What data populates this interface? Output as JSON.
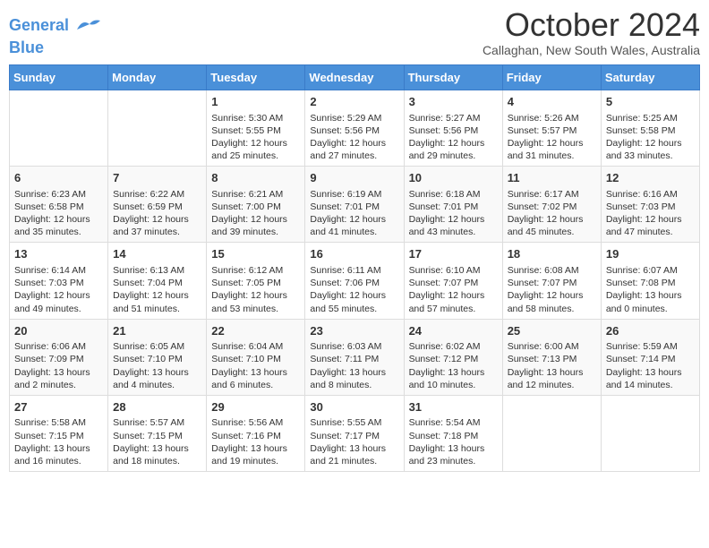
{
  "header": {
    "logo_line1": "General",
    "logo_line2": "Blue",
    "month": "October 2024",
    "location": "Callaghan, New South Wales, Australia"
  },
  "weekdays": [
    "Sunday",
    "Monday",
    "Tuesday",
    "Wednesday",
    "Thursday",
    "Friday",
    "Saturday"
  ],
  "weeks": [
    [
      {
        "day": "",
        "info": ""
      },
      {
        "day": "",
        "info": ""
      },
      {
        "day": "1",
        "info": "Sunrise: 5:30 AM\nSunset: 5:55 PM\nDaylight: 12 hours\nand 25 minutes."
      },
      {
        "day": "2",
        "info": "Sunrise: 5:29 AM\nSunset: 5:56 PM\nDaylight: 12 hours\nand 27 minutes."
      },
      {
        "day": "3",
        "info": "Sunrise: 5:27 AM\nSunset: 5:56 PM\nDaylight: 12 hours\nand 29 minutes."
      },
      {
        "day": "4",
        "info": "Sunrise: 5:26 AM\nSunset: 5:57 PM\nDaylight: 12 hours\nand 31 minutes."
      },
      {
        "day": "5",
        "info": "Sunrise: 5:25 AM\nSunset: 5:58 PM\nDaylight: 12 hours\nand 33 minutes."
      }
    ],
    [
      {
        "day": "6",
        "info": "Sunrise: 6:23 AM\nSunset: 6:58 PM\nDaylight: 12 hours\nand 35 minutes."
      },
      {
        "day": "7",
        "info": "Sunrise: 6:22 AM\nSunset: 6:59 PM\nDaylight: 12 hours\nand 37 minutes."
      },
      {
        "day": "8",
        "info": "Sunrise: 6:21 AM\nSunset: 7:00 PM\nDaylight: 12 hours\nand 39 minutes."
      },
      {
        "day": "9",
        "info": "Sunrise: 6:19 AM\nSunset: 7:01 PM\nDaylight: 12 hours\nand 41 minutes."
      },
      {
        "day": "10",
        "info": "Sunrise: 6:18 AM\nSunset: 7:01 PM\nDaylight: 12 hours\nand 43 minutes."
      },
      {
        "day": "11",
        "info": "Sunrise: 6:17 AM\nSunset: 7:02 PM\nDaylight: 12 hours\nand 45 minutes."
      },
      {
        "day": "12",
        "info": "Sunrise: 6:16 AM\nSunset: 7:03 PM\nDaylight: 12 hours\nand 47 minutes."
      }
    ],
    [
      {
        "day": "13",
        "info": "Sunrise: 6:14 AM\nSunset: 7:03 PM\nDaylight: 12 hours\nand 49 minutes."
      },
      {
        "day": "14",
        "info": "Sunrise: 6:13 AM\nSunset: 7:04 PM\nDaylight: 12 hours\nand 51 minutes."
      },
      {
        "day": "15",
        "info": "Sunrise: 6:12 AM\nSunset: 7:05 PM\nDaylight: 12 hours\nand 53 minutes."
      },
      {
        "day": "16",
        "info": "Sunrise: 6:11 AM\nSunset: 7:06 PM\nDaylight: 12 hours\nand 55 minutes."
      },
      {
        "day": "17",
        "info": "Sunrise: 6:10 AM\nSunset: 7:07 PM\nDaylight: 12 hours\nand 57 minutes."
      },
      {
        "day": "18",
        "info": "Sunrise: 6:08 AM\nSunset: 7:07 PM\nDaylight: 12 hours\nand 58 minutes."
      },
      {
        "day": "19",
        "info": "Sunrise: 6:07 AM\nSunset: 7:08 PM\nDaylight: 13 hours\nand 0 minutes."
      }
    ],
    [
      {
        "day": "20",
        "info": "Sunrise: 6:06 AM\nSunset: 7:09 PM\nDaylight: 13 hours\nand 2 minutes."
      },
      {
        "day": "21",
        "info": "Sunrise: 6:05 AM\nSunset: 7:10 PM\nDaylight: 13 hours\nand 4 minutes."
      },
      {
        "day": "22",
        "info": "Sunrise: 6:04 AM\nSunset: 7:10 PM\nDaylight: 13 hours\nand 6 minutes."
      },
      {
        "day": "23",
        "info": "Sunrise: 6:03 AM\nSunset: 7:11 PM\nDaylight: 13 hours\nand 8 minutes."
      },
      {
        "day": "24",
        "info": "Sunrise: 6:02 AM\nSunset: 7:12 PM\nDaylight: 13 hours\nand 10 minutes."
      },
      {
        "day": "25",
        "info": "Sunrise: 6:00 AM\nSunset: 7:13 PM\nDaylight: 13 hours\nand 12 minutes."
      },
      {
        "day": "26",
        "info": "Sunrise: 5:59 AM\nSunset: 7:14 PM\nDaylight: 13 hours\nand 14 minutes."
      }
    ],
    [
      {
        "day": "27",
        "info": "Sunrise: 5:58 AM\nSunset: 7:15 PM\nDaylight: 13 hours\nand 16 minutes."
      },
      {
        "day": "28",
        "info": "Sunrise: 5:57 AM\nSunset: 7:15 PM\nDaylight: 13 hours\nand 18 minutes."
      },
      {
        "day": "29",
        "info": "Sunrise: 5:56 AM\nSunset: 7:16 PM\nDaylight: 13 hours\nand 19 minutes."
      },
      {
        "day": "30",
        "info": "Sunrise: 5:55 AM\nSunset: 7:17 PM\nDaylight: 13 hours\nand 21 minutes."
      },
      {
        "day": "31",
        "info": "Sunrise: 5:54 AM\nSunset: 7:18 PM\nDaylight: 13 hours\nand 23 minutes."
      },
      {
        "day": "",
        "info": ""
      },
      {
        "day": "",
        "info": ""
      }
    ]
  ]
}
